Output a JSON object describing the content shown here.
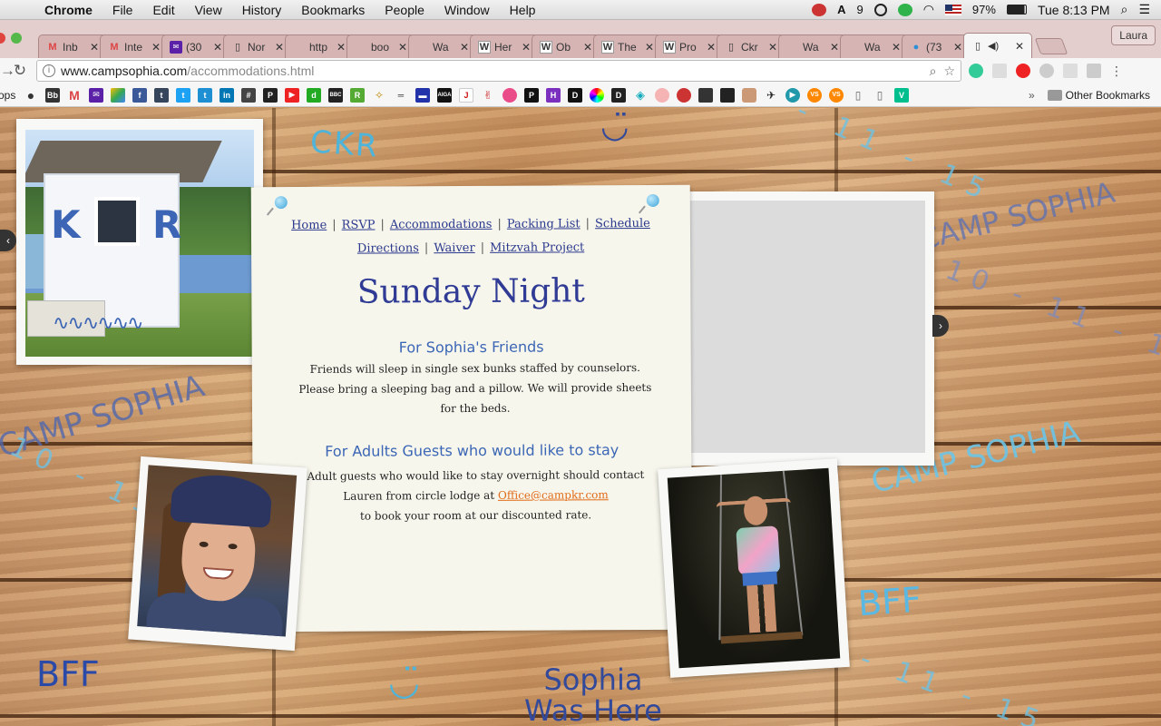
{
  "menubar": {
    "app_name": "Chrome",
    "items": [
      "File",
      "Edit",
      "View",
      "History",
      "Bookmarks",
      "People",
      "Window",
      "Help"
    ],
    "adobe_badge": "9",
    "battery": "97%",
    "clock": "Tue 8:13 PM"
  },
  "tabs": [
    {
      "title": "Inb",
      "icon": "gmail-icon"
    },
    {
      "title": "Inte",
      "icon": "gmail-icon"
    },
    {
      "title": "(30",
      "icon": "yahoo-mail-icon"
    },
    {
      "title": "Nor",
      "icon": "page-icon"
    },
    {
      "title": "http",
      "icon": "page-icon"
    },
    {
      "title": "boo",
      "icon": "page-icon"
    },
    {
      "title": "Wa",
      "icon": "page-icon"
    },
    {
      "title": "Her",
      "icon": "wikipedia-icon"
    },
    {
      "title": "Ob",
      "icon": "wikipedia-icon"
    },
    {
      "title": "The",
      "icon": "wikipedia-icon"
    },
    {
      "title": "Pro",
      "icon": "wikipedia-icon"
    },
    {
      "title": "Ckr",
      "icon": "page-icon"
    },
    {
      "title": "Wa",
      "icon": "page-icon"
    },
    {
      "title": "Wa",
      "icon": "page-icon"
    },
    {
      "title": "(73",
      "icon": "twitter-icon"
    },
    {
      "title": "",
      "icon": "page-icon",
      "active": true
    }
  ],
  "profile_name": "Laura",
  "address": {
    "host": "www.campsophia.com",
    "path": "/accommodations.html"
  },
  "bookmarks": {
    "apps_label": "ops",
    "other_label": "Other Bookmarks",
    "more_label": "»"
  },
  "page": {
    "nav_row1": [
      "Home",
      "RSVP",
      "Accommodations",
      "Packing List",
      "Schedule"
    ],
    "nav_row2": [
      "Directions",
      "Waiver",
      "Mitzvah Project"
    ],
    "title": "Sunday Night",
    "section1_title": "For Sophia's Friends",
    "section1_text": "Friends will sleep in single sex bunks staffed by counselors. Please bring a sleeping bag and a pillow. We will provide sheets for the beds.",
    "section2_title": "For Adults Guests who would like to stay",
    "section2_line1": "Adult guests who would like to stay overnight should contact Lauren from circle lodge at",
    "section2_email": "Office@campkr.com",
    "section2_line2": "to book your room at our discounted rate.",
    "shed_letter_k": "K",
    "shed_letter_r": "R"
  },
  "background": {
    "ckr": "CKR",
    "smile": "◡̈",
    "nums": "10 - 11 - 15",
    "camp_sophia": "CAMP SOPHIA",
    "bff": "BFF",
    "sophia_was_here_1": "Sophia",
    "sophia_was_here_2": "Was Here"
  },
  "colors": {
    "nav_link": "#2c3a8e",
    "title": "#2f3b94",
    "section_title": "#3b66b5",
    "email_link": "#e06b18"
  }
}
